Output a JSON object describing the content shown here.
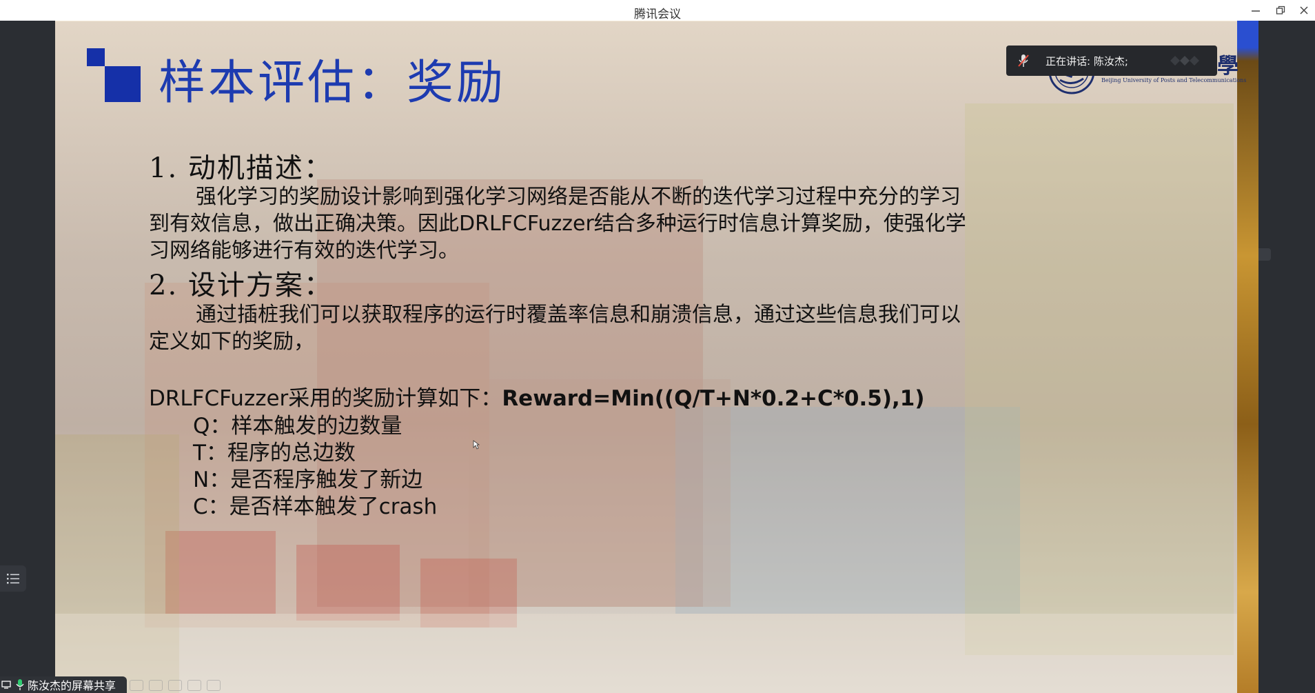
{
  "window": {
    "title": "腾讯会议"
  },
  "speaker": {
    "label": "正在讲话: 陈汝杰;"
  },
  "share_label": "陈汝杰的屏幕共享",
  "slide": {
    "title": "样本评估：奖励",
    "logo": {
      "name": "北京郵電大學",
      "subtitle": "Beijing University of Posts and Telecommunications"
    },
    "section1": {
      "heading": "1. 动机描述：",
      "lines": [
        "强化学习的奖励设计影响到强化学习网络是否能从不断的迭代学习过程中充分的学习",
        "到有效信息，做出正确决策。因此DRLFCFuzzer结合多种运行时信息计算奖励，使强化学",
        "习网络能够进行有效的迭代学习。"
      ]
    },
    "section2": {
      "heading": "2. 设计方案：",
      "lines": [
        "通过插桩我们可以获取程序的运行时覆盖率信息和崩溃信息，通过这些信息我们可以",
        "定义如下的奖励，"
      ]
    },
    "formula": {
      "prefix": "DRLFCFuzzer采用的奖励计算如下：",
      "expr": "Reward=Min((Q/T+N*0.2+C*0.5),1)"
    },
    "variables": [
      "Q：样本触发的边数量",
      "T：程序的总边数",
      "N：是否程序触发了新边",
      "C：是否样本触发了crash"
    ]
  },
  "colors": {
    "title_blue": "#1d3bb0",
    "logo_navy": "#1e2f6e",
    "frame_dark": "#2b2e33"
  },
  "icons": [
    "minimize-icon",
    "restore-icon",
    "close-icon",
    "muted-mic-icon",
    "mic-icon",
    "outline-list-icon",
    "university-emblem-icon"
  ]
}
